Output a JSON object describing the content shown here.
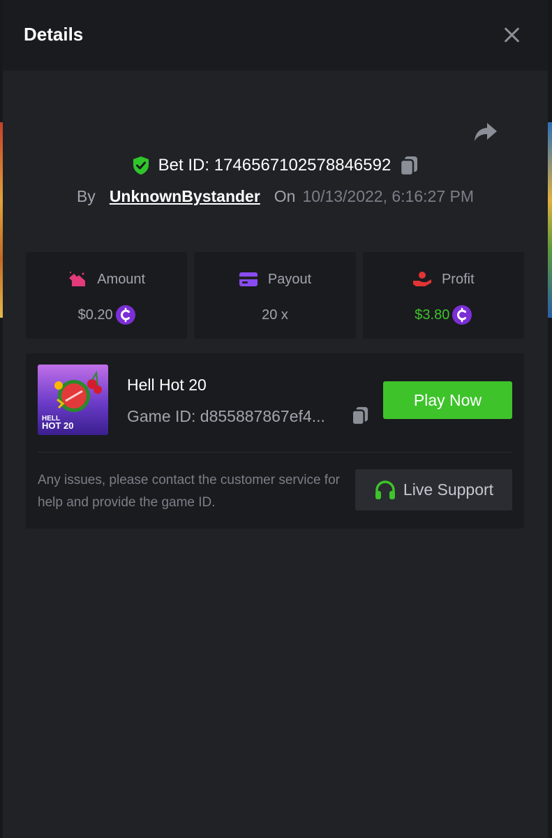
{
  "modal": {
    "title": "Details"
  },
  "bet": {
    "id_text": "Bet ID: 1746567102578846592",
    "by_label": "By",
    "username": "UnknownBystander",
    "on_label": "On",
    "datetime": "10/13/2022, 6:16:27 PM"
  },
  "stats": [
    {
      "label": "Amount",
      "value": "$0.20",
      "icon": "amount-icon",
      "currency_icon": "coin-icon"
    },
    {
      "label": "Payout",
      "value": "20 x",
      "icon": "card-icon"
    },
    {
      "label": "Profit",
      "value": "$3.80",
      "icon": "hand-coin-icon",
      "currency_icon": "coin-icon"
    }
  ],
  "game": {
    "name": "Hell Hot 20",
    "id_text": "Game ID: d855887867ef4...",
    "thumbnail_text_top": "HELL",
    "thumbnail_text_bottom": "HOT 20",
    "play_label": "Play Now"
  },
  "help": {
    "text": "Any issues, please contact the customer service for help and provide the game ID.",
    "support_label": "Live Support"
  },
  "colors": {
    "accent_green": "#3ec32b",
    "coin_purple": "#7b2fd6",
    "amount_pink": "#e23a7a",
    "payout_purple": "#8a4bf2",
    "profit_red": "#e23434"
  }
}
